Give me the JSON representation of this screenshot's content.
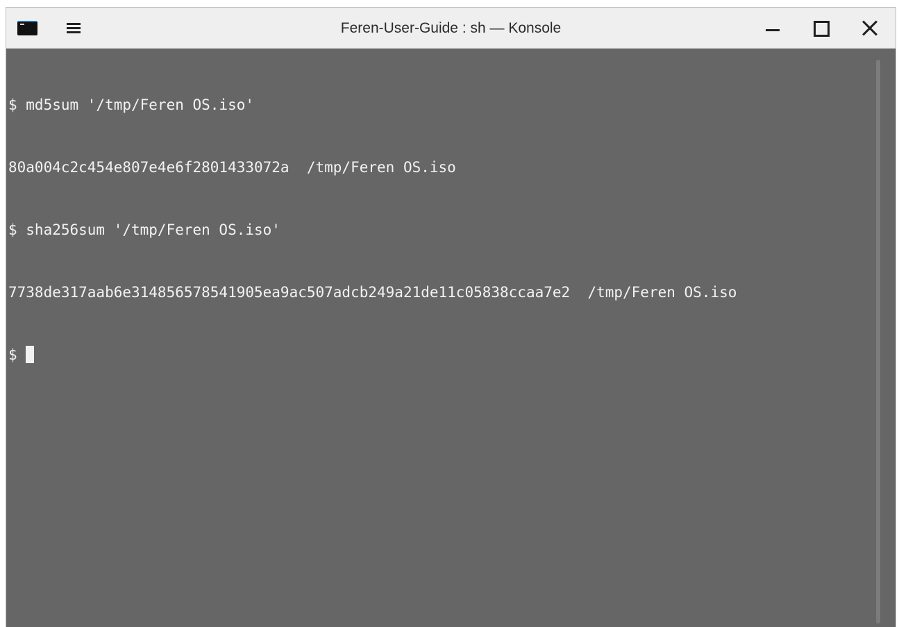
{
  "window": {
    "title": "Feren-User-Guide : sh — Konsole",
    "app_icon": "terminal-icon",
    "menu_icon": "hamburger-menu-icon",
    "controls": [
      "minimize-icon",
      "maximize-icon",
      "close-icon"
    ]
  },
  "terminal": {
    "lines": [
      "$ md5sum '/tmp/Feren OS.iso'",
      "80a004c2c454e807e4e6f2801433072a  /tmp/Feren OS.iso",
      "$ sha256sum '/tmp/Feren OS.iso'",
      "7738de317aab6e314856578541905ea9ac507adcb249a21de11c05838ccaa7e2  /tmp/Feren OS.iso"
    ],
    "prompt": "$ "
  },
  "colors": {
    "terminal_background": "#666666",
    "terminal_text": "#f2f2f2",
    "titlebar_background": "#efefef"
  }
}
